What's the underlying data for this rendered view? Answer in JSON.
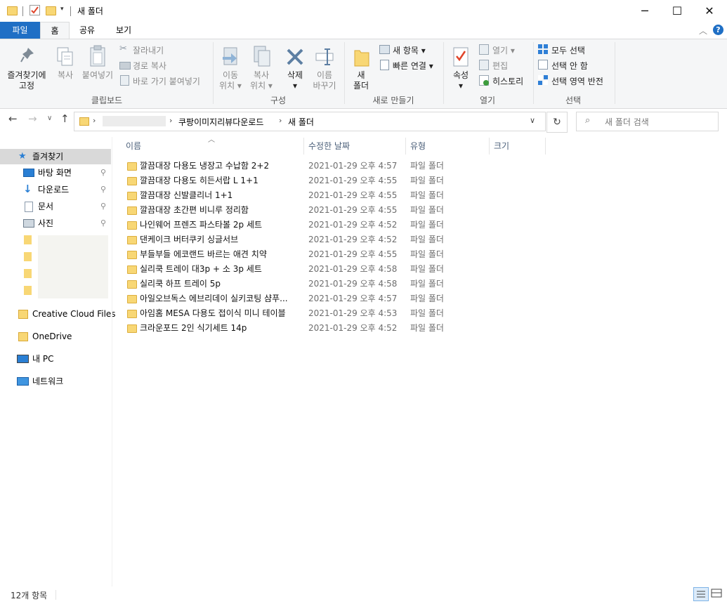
{
  "window": {
    "title": "새 폴더",
    "minimize_icon": "minimize-icon",
    "maximize_icon": "maximize-icon",
    "close_icon": "close-icon"
  },
  "tabs": {
    "file": "파일",
    "home": "홈",
    "share": "공유",
    "view": "보기"
  },
  "ribbon": {
    "clipboard": {
      "group": "클립보드",
      "pin": "즐겨찾기에\n고정",
      "copy": "복사",
      "paste": "붙여넣기",
      "cut": "잘라내기",
      "copy_path": "경로 복사",
      "paste_shortcut": "바로 가기 붙여넣기"
    },
    "organize": {
      "group": "구성",
      "move_to": "이동\n위치 ▾",
      "copy_to": "복사\n위치 ▾",
      "delete": "삭제\n▾",
      "rename": "이름\n바꾸기"
    },
    "new": {
      "group": "새로 만들기",
      "new_folder": "새\n폴더",
      "new_item": "새 항목 ▾",
      "easy_access": "빠른 연결 ▾"
    },
    "open": {
      "group": "열기",
      "properties": "속성\n▾",
      "open": "열기 ▾",
      "edit": "편집",
      "history": "히스토리"
    },
    "select": {
      "group": "선택",
      "select_all": "모두 선택",
      "select_none": "선택 안 함",
      "invert": "선택 영역 반전"
    }
  },
  "address": {
    "path": [
      "쿠팡이미지리뷰다운로드",
      "새 폴더"
    ],
    "search_placeholder": "새 폴더 검색"
  },
  "nav_pane": {
    "quick_access": "즐겨찾기",
    "items": [
      "바탕 화면",
      "다운로드",
      "문서",
      "사진"
    ],
    "creative_cloud": "Creative Cloud Files",
    "onedrive": "OneDrive",
    "this_pc": "내 PC",
    "network": "네트워크"
  },
  "columns": {
    "name": "이름",
    "modified": "수정한 날짜",
    "type": "유형",
    "size": "크기"
  },
  "files": [
    {
      "name": "깔끔대장 다용도 냉장고 수납함 2+2",
      "date": "2021-01-29 오후 4:57",
      "type": "파일 폴더"
    },
    {
      "name": "깔끔대장 다용도 히든서랍 L 1+1",
      "date": "2021-01-29 오후 4:55",
      "type": "파일 폴더"
    },
    {
      "name": "깔끔대장 신발클리너 1+1",
      "date": "2021-01-29 오후 4:55",
      "type": "파일 폴더"
    },
    {
      "name": "깔끔대장 초간편 비니루 정리함",
      "date": "2021-01-29 오후 4:55",
      "type": "파일 폴더"
    },
    {
      "name": "나인웨어 프렌즈 파스타볼 2p 세트",
      "date": "2021-01-29 오후 4:52",
      "type": "파일 폴더"
    },
    {
      "name": "댄케이크 버터쿠키 싱글서브",
      "date": "2021-01-29 오후 4:52",
      "type": "파일 폴더"
    },
    {
      "name": "부들부들 에코랜드 바르는 애견 치약",
      "date": "2021-01-29 오후 4:55",
      "type": "파일 폴더"
    },
    {
      "name": "실리쿡 트레이 대3p + 소 3p 세트",
      "date": "2021-01-29 오후 4:58",
      "type": "파일 폴더"
    },
    {
      "name": "실리쿡 하프 트레이 5p",
      "date": "2021-01-29 오후 4:58",
      "type": "파일 폴더"
    },
    {
      "name": "아일오브독스 에브리데이 실키코팅 샴푸...",
      "date": "2021-01-29 오후 4:57",
      "type": "파일 폴더"
    },
    {
      "name": "아임홈 MESA 다용도 접이식 미니 테이블",
      "date": "2021-01-29 오후 4:53",
      "type": "파일 폴더"
    },
    {
      "name": "크라운포드 2인 식기세트 14p",
      "date": "2021-01-29 오후 4:52",
      "type": "파일 폴더"
    }
  ],
  "status": {
    "count": "12개 항목"
  },
  "colors": {
    "accent": "#1f6fc5",
    "folder": "#f8d775",
    "selected_nav": "#d9d9d9"
  }
}
